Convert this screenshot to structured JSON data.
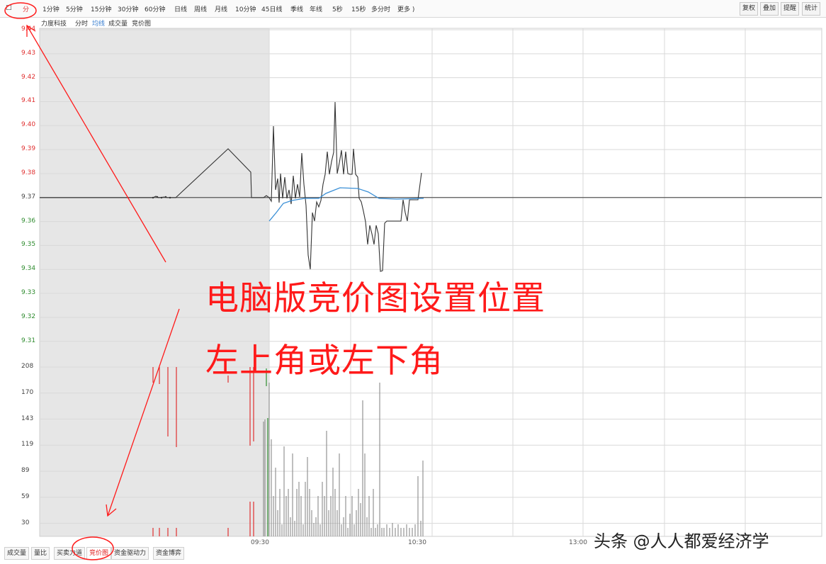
{
  "colors": {
    "annotation_red": "#ff1a1a",
    "up_red": "#e03030",
    "down_green": "#2e8b2e",
    "avg_blue": "#3a8fd6",
    "price_line": "#333333",
    "preopen_shade": "#e6e6e6",
    "grid": "#d9d9d9"
  },
  "toolbar": {
    "left_icon_1": "□",
    "left_icon_2": "分",
    "period_items": [
      "1分钟",
      "5分钟",
      "15分钟",
      "30分钟",
      "60分钟",
      "日线",
      "周线",
      "月线",
      "10分钟",
      "45日线",
      "季线",
      "年线",
      "5秒",
      "15秒",
      "多分时",
      "更多 )"
    ],
    "right_buttons": [
      "复权",
      "叠加",
      "提醒",
      "统计"
    ]
  },
  "subbar": {
    "items": [
      "力度科技",
      "分时",
      "均线",
      "成交量",
      "竞价图"
    ],
    "active_index": 2
  },
  "price_axis": {
    "labels": [
      "9.44",
      "9.43",
      "9.42",
      "9.41",
      "9.40",
      "9.39",
      "9.38",
      "9.37",
      "9.36",
      "9.35",
      "9.34",
      "9.33",
      "9.32",
      "9.31"
    ],
    "preclose": "9.37"
  },
  "volume_axis": {
    "labels": [
      "208",
      "170",
      "143",
      "119",
      "89",
      "59",
      "30"
    ]
  },
  "time_axis": {
    "labels": [
      "09:30",
      "10:30",
      "13:00"
    ]
  },
  "bottom_tabs": {
    "items": [
      "成交量",
      "量比",
      "买卖力道",
      "竞价图",
      "资金驱动力",
      "资金博弈"
    ],
    "active_index": 3
  },
  "annotation": {
    "line1": "电脑版竞价图设置位置",
    "line2": "左上角或左下角"
  },
  "watermark": {
    "text": "头条 @人人都爱经济学"
  }
}
